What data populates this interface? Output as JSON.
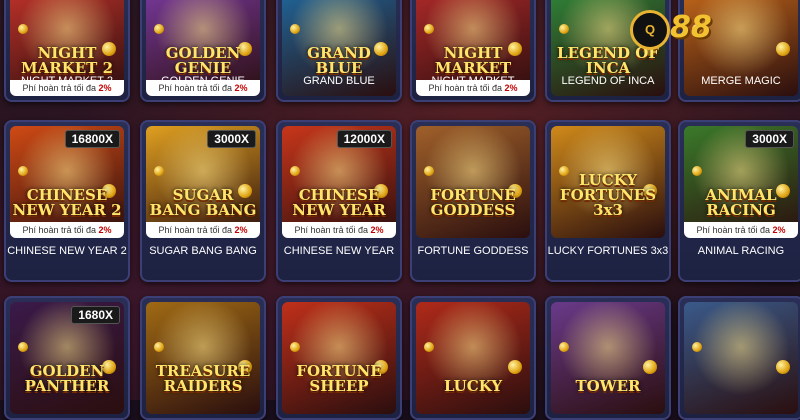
{
  "brand": {
    "logo_text": "88",
    "logo_badge": "Q"
  },
  "refund_prefix": "Phí hoàn trả tối đa",
  "refund_value": "2%",
  "rows": [
    [
      {
        "name": "NIGHT MARKET 2",
        "title": "NIGHT MARKET 2",
        "mult": "",
        "refund": true
      },
      {
        "name": "GOLDEN GENIE",
        "title": "GOLDEN GENIE",
        "mult": "",
        "refund": true
      },
      {
        "name": "GRAND BLUE",
        "title": "GRAND BLUE",
        "mult": "",
        "refund": false
      },
      {
        "name": "NIGHT MARKET",
        "title": "NIGHT MARKET",
        "mult": "",
        "refund": true
      },
      {
        "name": "LEGEND OF INCA",
        "title": "LEGEND OF INCA",
        "mult": "",
        "refund": false
      },
      {
        "name": "MERGE MAGIC",
        "title": "",
        "mult": "",
        "refund": false
      }
    ],
    [
      {
        "name": "CHINESE NEW YEAR 2",
        "title": "CHINESE NEW YEAR 2",
        "mult": "16800X",
        "refund": true
      },
      {
        "name": "SUGAR BANG BANG",
        "title": "SUGAR BANG BANG",
        "mult": "3000X",
        "refund": true
      },
      {
        "name": "CHINESE NEW YEAR",
        "title": "CHINESE NEW YEAR",
        "mult": "12000X",
        "refund": true
      },
      {
        "name": "FORTUNE GODDESS",
        "title": "FORTUNE GODDESS",
        "mult": "",
        "refund": false
      },
      {
        "name": "LUCKY FORTUNES 3x3",
        "title": "LUCKY FORTUNES 3x3",
        "mult": "",
        "refund": false
      },
      {
        "name": "ANIMAL RACING",
        "title": "ANIMAL RACING",
        "mult": "3000X",
        "refund": true
      }
    ],
    [
      {
        "name": "",
        "title": "GOLDEN PANTHER",
        "mult": "1680X",
        "refund": false
      },
      {
        "name": "",
        "title": "TREASURE RAIDERS",
        "mult": "",
        "refund": false
      },
      {
        "name": "",
        "title": "FORTUNE SHEEP",
        "mult": "",
        "refund": false
      },
      {
        "name": "",
        "title": "LUCKY",
        "mult": "",
        "refund": false
      },
      {
        "name": "",
        "title": "TOWER",
        "mult": "",
        "refund": false
      },
      {
        "name": "",
        "title": "",
        "mult": "",
        "refund": false
      }
    ]
  ],
  "palette": [
    "#c2332a",
    "#7a3aa0",
    "#1f6aa0",
    "#b22a2a",
    "#2f8a3a",
    "#c76a1a",
    "#d04a14",
    "#e0a020",
    "#c8361a",
    "#a0602a",
    "#d08a1a",
    "#3a7a2a",
    "#3a1a4a",
    "#a06a14",
    "#c0301a",
    "#b02a1a",
    "#6a3a8a",
    "#3a5a8a"
  ]
}
